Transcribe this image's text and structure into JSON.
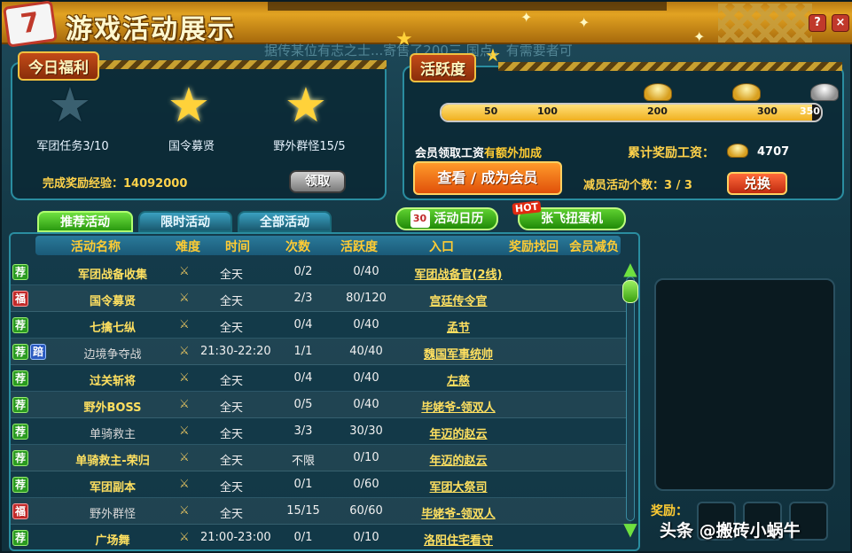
{
  "window": {
    "title": "游戏活动展示",
    "calendar_day": "7",
    "help_label": "?",
    "close_label": "×"
  },
  "background_text": "据传某位有志之士...寄售了200三 国点，有需要者可",
  "welfare": {
    "tag": "今日福利",
    "items": [
      {
        "label": "军团任务3/10",
        "state": "incomplete"
      },
      {
        "label": "国令募贤",
        "state": "complete"
      },
      {
        "label": "野外群怪15/5",
        "state": "complete"
      }
    ],
    "exp_label": "完成奖励经验：14092000",
    "claim_label": "领取"
  },
  "activity": {
    "tag": "活跃度",
    "progress_value": 342,
    "progress_max": 350,
    "ticks": [
      "50",
      "100",
      "200",
      "300",
      "350"
    ],
    "member_hint_prefix": "会员领取工资",
    "member_hint_suffix": "有额外加成",
    "member_button": "查看 / 成为会员",
    "salary_label": "累计奖励工资：",
    "salary_value": "4707",
    "reduce_label": "减员活动个数：3 / 3",
    "exchange_label": "兑换"
  },
  "tabs": [
    {
      "label": "推荐活动",
      "active": true
    },
    {
      "label": "限时活动",
      "active": false
    },
    {
      "label": "全部活动",
      "active": false
    }
  ],
  "calendar_button": {
    "day": "30",
    "label": "活动日历"
  },
  "gacha_button": {
    "hot": "HOT",
    "label": "张飞扭蛋机"
  },
  "table": {
    "headers": [
      "活动名称",
      "难度",
      "时间",
      "次数",
      "活跃度",
      "入口",
      "奖励找回",
      "会员减负"
    ],
    "rows": [
      {
        "badges": [
          "荐"
        ],
        "name": "军团战备收集",
        "time": "全天",
        "count": "0/2",
        "active": "0/40",
        "entry": "军团战备官(2线)",
        "done": false
      },
      {
        "badges": [
          "福"
        ],
        "name": "国令募贤",
        "time": "全天",
        "count": "2/3",
        "active": "80/120",
        "entry": "宫廷传令官",
        "done": false
      },
      {
        "badges": [
          "荐"
        ],
        "name": "七擒七纵",
        "time": "全天",
        "count": "0/4",
        "active": "0/40",
        "entry": "孟节",
        "done": false
      },
      {
        "badges": [
          "荐",
          "踣"
        ],
        "name": "边境争夺战",
        "time": "21:30-22:20",
        "count": "1/1",
        "active": "40/40",
        "entry": "魏国军事统帅",
        "done": true
      },
      {
        "badges": [
          "荐"
        ],
        "name": "过关斩将",
        "time": "全天",
        "count": "0/4",
        "active": "0/40",
        "entry": "左慈",
        "done": false
      },
      {
        "badges": [
          "荐"
        ],
        "name": "野外BOSS",
        "time": "全天",
        "count": "0/5",
        "active": "0/40",
        "entry": "毕姥爷-领双人",
        "done": false
      },
      {
        "badges": [
          "荐"
        ],
        "name": "单骑救主",
        "time": "全天",
        "count": "3/3",
        "active": "30/30",
        "entry": "年迈的赵云",
        "done": true
      },
      {
        "badges": [
          "荐"
        ],
        "name": "单骑救主-荣归",
        "time": "全天",
        "count": "不限",
        "active": "0/10",
        "entry": "年迈的赵云",
        "done": false
      },
      {
        "badges": [
          "荐"
        ],
        "name": "军团副本",
        "time": "全天",
        "count": "0/1",
        "active": "0/60",
        "entry": "军团大祭司",
        "done": false
      },
      {
        "badges": [
          "福"
        ],
        "name": "野外群怪",
        "time": "全天",
        "count": "15/15",
        "active": "60/60",
        "entry": "毕姥爷-领双人",
        "done": true
      },
      {
        "badges": [
          "荐"
        ],
        "name": "广场舞",
        "time": "21:00-23:00",
        "count": "0/1",
        "active": "0/10",
        "entry": "洛阳住宅看守",
        "done": false
      }
    ]
  },
  "reward_label": "奖励：",
  "watermark": "头条 @搬砖小蜗牛",
  "colors": {
    "accent_gold": "#ffcc33",
    "panel_border": "#2a8da0",
    "active_tab": "#2a9a10"
  }
}
